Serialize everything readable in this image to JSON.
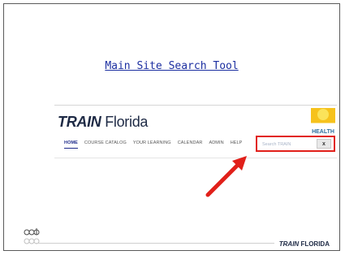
{
  "slide": {
    "title": "Main Site Search Tool"
  },
  "screenshot": {
    "brand_prefix": "TRAIN",
    "brand_state": "Florida",
    "state_logo_text": "HEALTH",
    "nav_items": [
      "HOME",
      "COURSE CATALOG",
      "YOUR LEARNING",
      "CALENDAR",
      "ADMIN",
      "HELP"
    ],
    "search": {
      "placeholder": "Search TRAIN",
      "clear_label": "x"
    }
  },
  "footer": {
    "brand_prefix": "TRAIN",
    "brand_state": "FLORIDA"
  },
  "colors": {
    "title_link": "#1c2fa1",
    "highlight": "#e1201a",
    "arrow": "#e1201a"
  }
}
